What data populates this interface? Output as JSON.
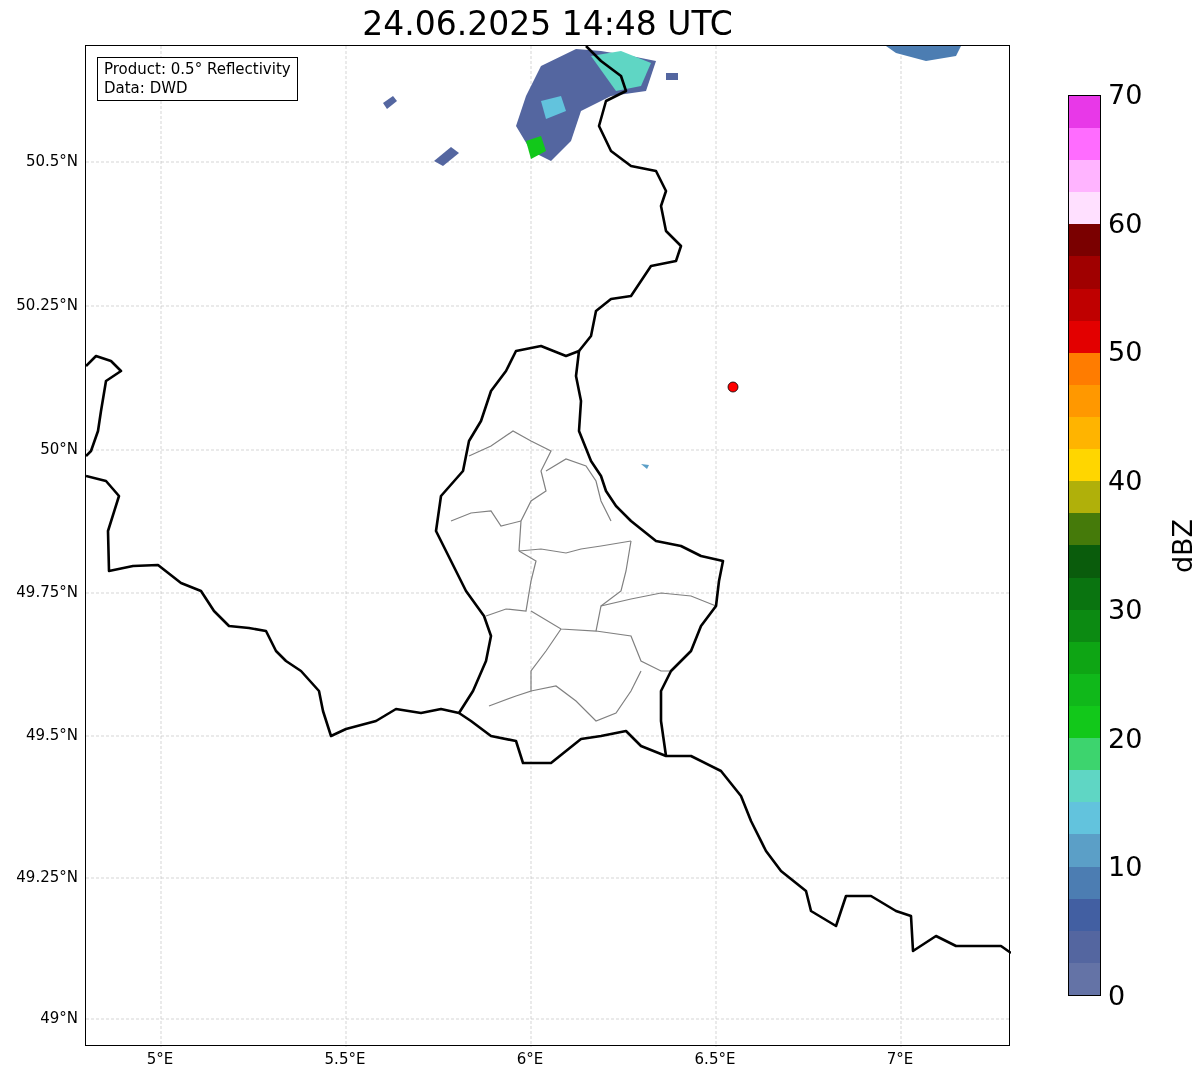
{
  "title": "24.06.2025 14:48 UTC",
  "legend": [
    "Product: 0.5° Reflectivity",
    "Data: DWD"
  ],
  "y_ticks": [
    "50.5°N",
    "50.25°N",
    "50°N",
    "49.75°N",
    "49.5°N",
    "49.25°N",
    "49°N"
  ],
  "x_ticks": [
    "5°E",
    "5.5°E",
    "6°E",
    "6.5°E",
    "7°E"
  ],
  "colorbar": {
    "label": "dBZ",
    "ticks": [
      "70",
      "60",
      "50",
      "40",
      "30",
      "20",
      "10",
      "0"
    ],
    "bands": [
      {
        "color": "#6473a6"
      },
      {
        "color": "#5466a0"
      },
      {
        "color": "#425fa2"
      },
      {
        "color": "#4c7db2"
      },
      {
        "color": "#5b9fc7"
      },
      {
        "color": "#62c3dd"
      },
      {
        "color": "#5fd6c4"
      },
      {
        "color": "#3dd46e"
      },
      {
        "color": "#12c81a"
      },
      {
        "color": "#10b81a"
      },
      {
        "color": "#0ea514"
      },
      {
        "color": "#0c8a12"
      },
      {
        "color": "#0a7410"
      },
      {
        "color": "#0a5c0c"
      },
      {
        "color": "#457a0a"
      },
      {
        "color": "#b0b00a"
      },
      {
        "color": "#ffd600"
      },
      {
        "color": "#ffb400"
      },
      {
        "color": "#ff9800"
      },
      {
        "color": "#ff7c00"
      },
      {
        "color": "#e30000"
      },
      {
        "color": "#bf0000"
      },
      {
        "color": "#a00000"
      },
      {
        "color": "#7a0000"
      },
      {
        "color": "#ffe0ff"
      },
      {
        "color": "#ffb4ff"
      },
      {
        "color": "#ff6cff"
      },
      {
        "color": "#e838e8"
      }
    ]
  }
}
